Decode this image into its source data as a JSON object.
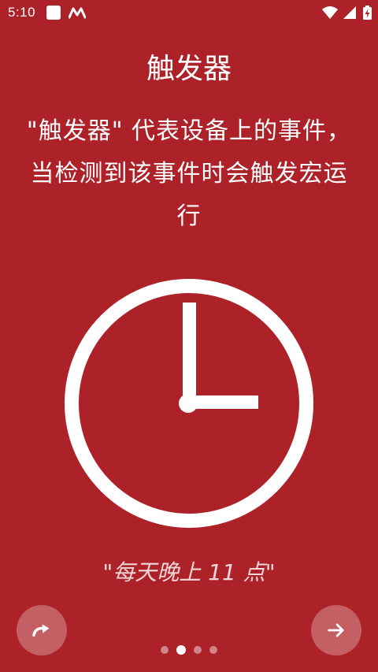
{
  "status_bar": {
    "time": "5:10",
    "icons": [
      "notification-square-icon",
      "app-m-icon",
      "wifi-icon",
      "cell-signal-icon",
      "battery-charging-icon"
    ]
  },
  "screen": {
    "title": "触发器",
    "description": "\"触发器\" 代表设备上的事件，当检测到该事件时会触发宏运行",
    "example": "\"每天晚上 11 点\"",
    "illustration_icon": "clock-icon"
  },
  "navigation": {
    "skip_icon": "redo-arrow-icon",
    "next_icon": "arrow-right-icon",
    "page_count": 4,
    "current_page": 2
  },
  "colors": {
    "background": "#AD2229",
    "foreground": "#FFFFFF"
  }
}
